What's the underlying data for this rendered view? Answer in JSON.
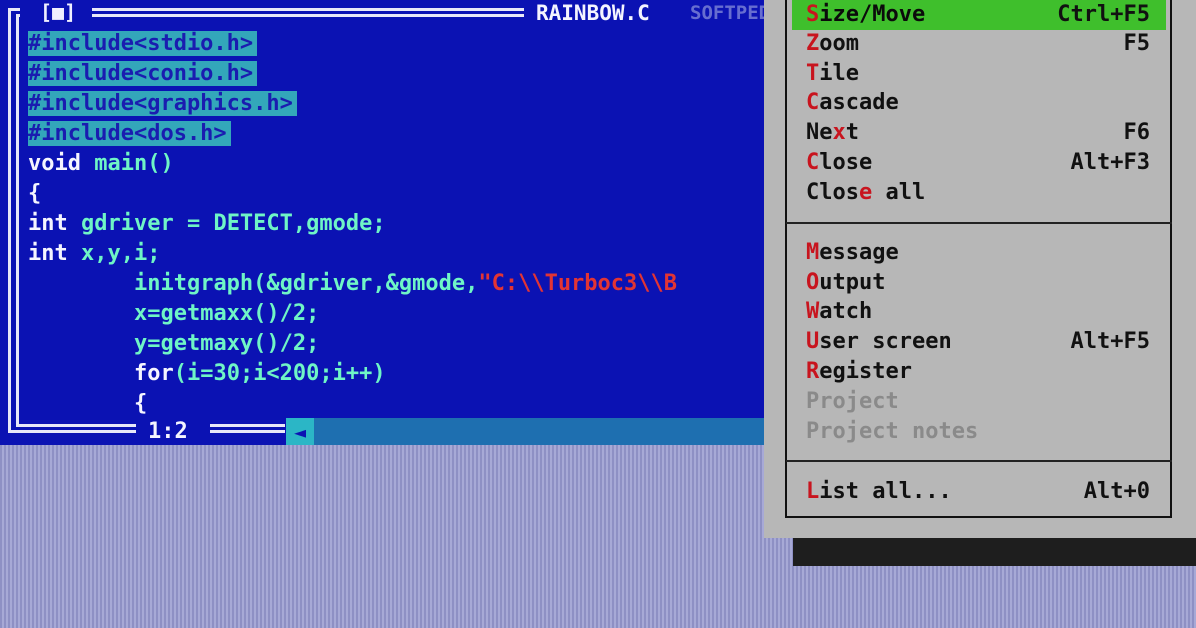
{
  "editor": {
    "close_box": "[■]",
    "title": "RAINBOW.C",
    "title_watermark": "SOFTPEDIA",
    "lines": [
      {
        "pp": "#include<stdio.h>"
      },
      {
        "pp": "#include<conio.h>"
      },
      {
        "pp": "#include<graphics.h>"
      },
      {
        "pp": "#include<dos.h>"
      },
      {
        "a": "void",
        "b": " main()"
      },
      {
        "a": "{"
      },
      {
        "a": "int",
        "b": " gdriver = DETECT,gmode;"
      },
      {
        "a": "int",
        "b": " x,y,i;"
      },
      {
        "indent": "        ",
        "b": "initgraph(&gdriver,&gmode,",
        "s": "\"C:\\\\Turboc3\\\\B"
      },
      {
        "indent": "        ",
        "b": "x=getmaxx()/2;"
      },
      {
        "indent": "        ",
        "b": "y=getmaxy()/2;"
      },
      {
        "indent": "        ",
        "a": "for",
        "b": "(i=30;i<200;i++)"
      },
      {
        "indent": "        ",
        "a": "{"
      }
    ],
    "cursor_position": "1:2",
    "scroll_left_arrow": "◄"
  },
  "menu": {
    "items": [
      {
        "pre": "",
        "hot": "S",
        "post": "ize/Move",
        "shortcut": "Ctrl+F5",
        "state": "selected"
      },
      {
        "pre": "",
        "hot": "Z",
        "post": "oom",
        "shortcut": "F5",
        "state": "normal"
      },
      {
        "pre": "",
        "hot": "T",
        "post": "ile",
        "shortcut": "",
        "state": "normal"
      },
      {
        "pre": "",
        "hot": "C",
        "post": "ascade",
        "shortcut": "",
        "state": "normal"
      },
      {
        "pre": "Ne",
        "hot": "x",
        "post": "t",
        "shortcut": "F6",
        "state": "normal"
      },
      {
        "pre": "",
        "hot": "C",
        "post": "lose",
        "shortcut": "Alt+F3",
        "state": "normal"
      },
      {
        "pre": "Clos",
        "hot": "e",
        "post": " all",
        "shortcut": "",
        "state": "normal"
      },
      {
        "pre": "",
        "hot": "M",
        "post": "essage",
        "shortcut": "",
        "state": "normal"
      },
      {
        "pre": "",
        "hot": "O",
        "post": "utput",
        "shortcut": "",
        "state": "normal"
      },
      {
        "pre": "",
        "hot": "W",
        "post": "atch",
        "shortcut": "",
        "state": "normal"
      },
      {
        "pre": "",
        "hot": "U",
        "post": "ser screen",
        "shortcut": "Alt+F5",
        "state": "normal"
      },
      {
        "pre": "",
        "hot": "R",
        "post": "egister",
        "shortcut": "",
        "state": "normal"
      },
      {
        "pre": "Project",
        "hot": "",
        "post": "",
        "shortcut": "",
        "state": "disabled"
      },
      {
        "pre": "Project notes",
        "hot": "",
        "post": "",
        "shortcut": "",
        "state": "disabled"
      },
      {
        "pre": "",
        "hot": "L",
        "post": "ist all...",
        "shortcut": "Alt+0",
        "state": "normal"
      }
    ]
  },
  "colors": {
    "editor_bg": "#0b12b3",
    "menu_bg": "#b7b7b7",
    "menu_selected": "#3fbf2c",
    "hotkey": "#c8141e",
    "preprocessor_bg": "#33a7ba",
    "identifier": "#6ff5c6",
    "string": "#e23434"
  }
}
